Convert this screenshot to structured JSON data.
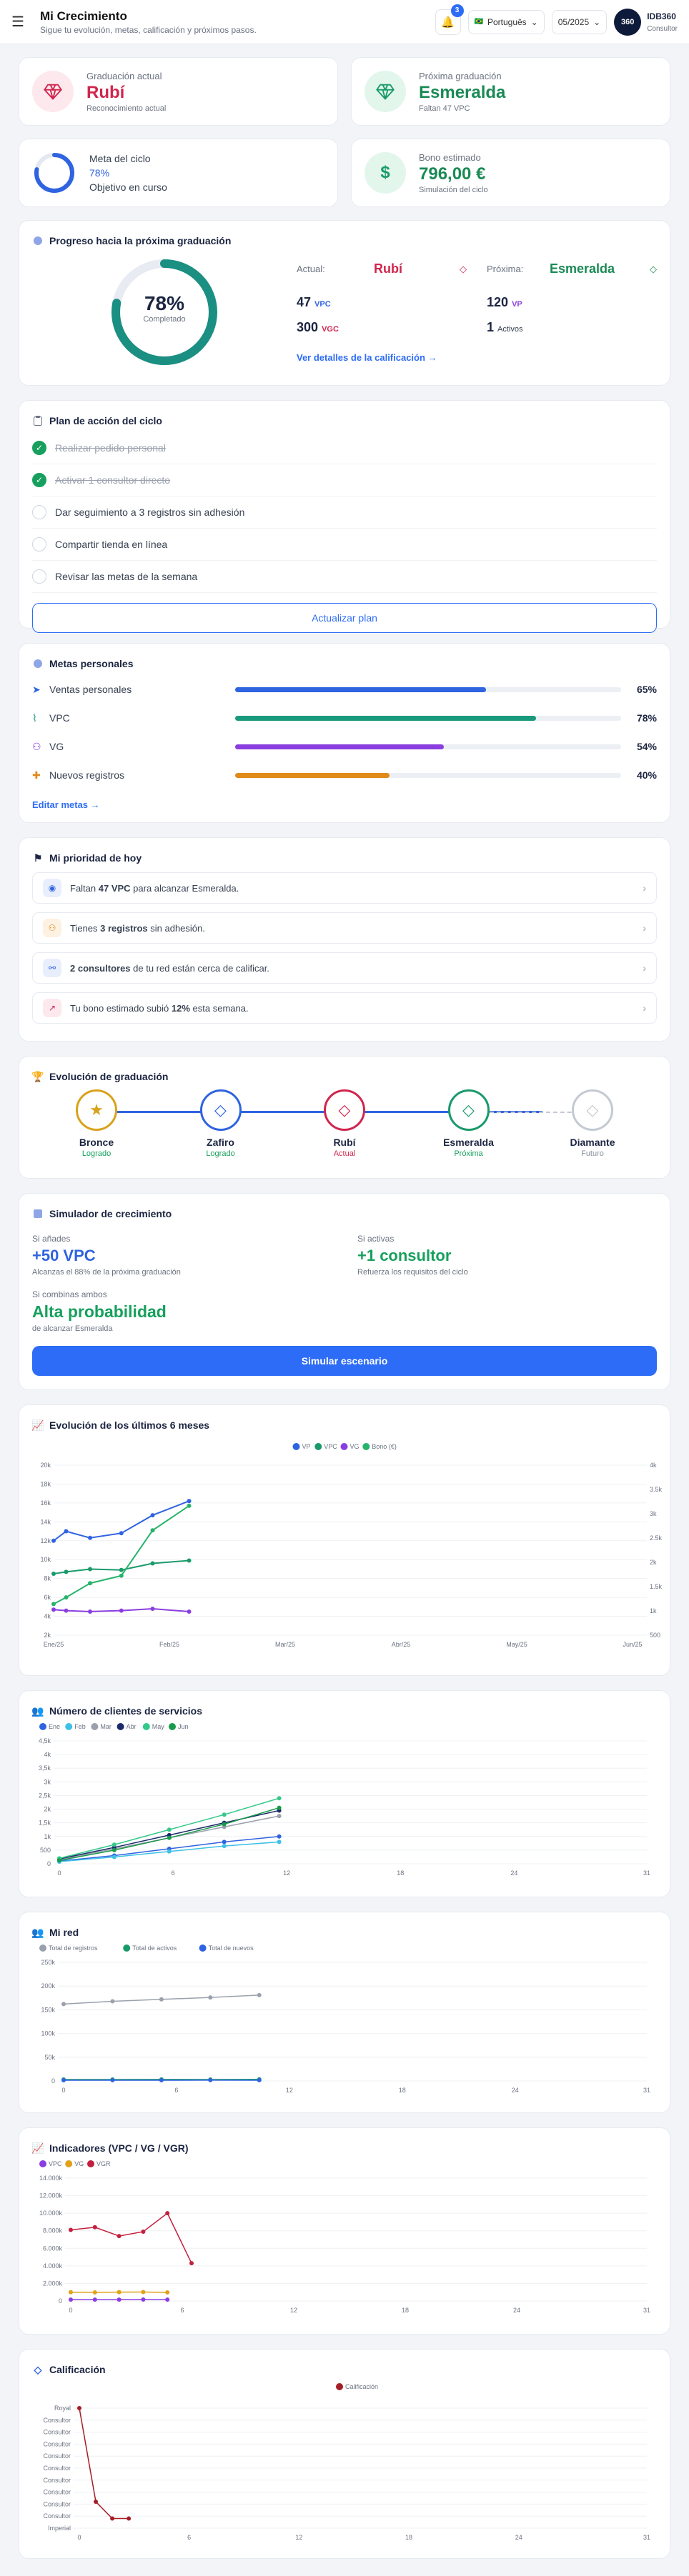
{
  "topbar": {
    "title": "Mi Crecimiento",
    "subtitle": "Sigue tu evolución, metas, calificación y próximos pasos.",
    "notif_count": "3",
    "language": "Português",
    "period": "05/2025",
    "avatar": "360",
    "user_id": "IDB360",
    "user_role": "Consultor"
  },
  "summary": {
    "current_grad": {
      "label": "Graduación actual",
      "value": "Rubí",
      "sub": "Reconocimiento actual"
    },
    "next_grad": {
      "label": "Próxima graduación",
      "value": "Esmeralda",
      "sub": "Faltan 47 VPC"
    },
    "cycle_goal": {
      "label": "Meta del ciclo",
      "value": "78%",
      "sub": "Objetivo en curso",
      "progress": 0.78
    },
    "bonus": {
      "label": "Bono estimado",
      "value": "796,00 €",
      "sub": "Simulación del ciclo"
    }
  },
  "progress": {
    "title": "Progreso hacia la próxima graduación",
    "pct": "78%",
    "pct_label": "Completado",
    "ring": 0.78,
    "current_label": "Actual:",
    "current_value": "Rubí",
    "next_label": "Próxima:",
    "next_value": "Esmeralda",
    "cur_vpc": "47",
    "cur_vpc_unit": "VPC",
    "cur_vgc": "300",
    "cur_vgc_unit": "VGC",
    "next_vp": "120",
    "next_vp_unit": "VP",
    "next_act": "1",
    "next_act_unit": "Activos",
    "details_link": "Ver detalles de la calificación →"
  },
  "plan": {
    "title": "Plan de acción del ciclo",
    "items": [
      {
        "label": "Realizar pedido personal",
        "done": true
      },
      {
        "label": "Activar 1 consultor directo",
        "done": true
      },
      {
        "label": "Dar seguimiento a 3 registros sin adhesión",
        "done": false
      },
      {
        "label": "Compartir tienda en línea",
        "done": false
      },
      {
        "label": "Revisar las metas de la semana",
        "done": false
      }
    ],
    "button": "Actualizar plan"
  },
  "goals": {
    "title": "Metas personales",
    "items": [
      {
        "label": "Ventas personales",
        "pct": "65%",
        "value": 0.65,
        "color": "#2f63e0"
      },
      {
        "label": "VPC",
        "pct": "78%",
        "value": 0.78,
        "color": "#1a9a7c"
      },
      {
        "label": "VG",
        "pct": "54%",
        "value": 0.54,
        "color": "#8a3ee0"
      },
      {
        "label": "Nuevos registros",
        "pct": "40%",
        "value": 0.4,
        "color": "#e08a1a"
      }
    ],
    "link": "Editar metas →"
  },
  "priority": {
    "title": "Mi prioridad de hoy",
    "items": [
      {
        "pre": "Faltan ",
        "bold": "47 VPC",
        "post": " para alcanzar Esmeralda."
      },
      {
        "pre": "Tienes ",
        "bold": "3 registros",
        "post": " sin adhesión."
      },
      {
        "pre": "",
        "bold": "2 consultores",
        "post": " de tu red están cerca de calificar."
      },
      {
        "pre": "Tu bono estimado subió ",
        "bold": "12%",
        "post": " esta semana."
      }
    ]
  },
  "evolution": {
    "title": "Evolución de graduación",
    "steps": [
      {
        "name": "Bronce",
        "status": "Logrado",
        "color": "#d9a21b",
        "scolor": "#17a05d"
      },
      {
        "name": "Zafiro",
        "status": "Logrado",
        "color": "#2f63e0",
        "scolor": "#17a05d"
      },
      {
        "name": "Rubí",
        "status": "Actual",
        "color": "#d0264d",
        "scolor": "#d0264d"
      },
      {
        "name": "Esmeralda",
        "status": "Próxima",
        "color": "#1a9a6b",
        "scolor": "#17a05d"
      },
      {
        "name": "Diamante",
        "status": "Futuro",
        "color": "#c4c9d2",
        "scolor": "#8a919e"
      }
    ]
  },
  "simulator": {
    "title": "Simulador de crecimiento",
    "a_label": "Si añades",
    "a_value": "+50 VPC",
    "a_sub": "Alcanzas el 88% de la próxima graduación",
    "b_label": "Si activas",
    "b_value": "+1 consultor",
    "b_sub": "Refuerza los requisitos del ciclo",
    "c_label": "Si combinas ambos",
    "c_value": "Alta probabilidad",
    "c_sub": "de alcanzar Esmeralda",
    "button": "Simular escenario"
  },
  "charts": {
    "evo6": {
      "title": "Evolución de los últimos 6 meses"
    },
    "clients": {
      "title": "Número de clientes de servicios"
    },
    "net": {
      "title": "Mi red"
    },
    "ind": {
      "title": "Indicadores (VPC / VG / VGR)"
    },
    "qual": {
      "title": "Calificación"
    }
  },
  "chart_data": [
    {
      "type": "line",
      "title": "Evolución de los últimos 6 meses",
      "categories": [
        "Ene/25",
        "Feb/25",
        "Mar/25",
        "Abr/25",
        "May/25",
        "Jun/25"
      ],
      "ylim": [
        2000,
        20000
      ],
      "y2lim": [
        500,
        4000
      ],
      "yticks": [
        "20k",
        "18k",
        "16k",
        "14k",
        "12k",
        "10k",
        "8k",
        "6k",
        "4k",
        "2k"
      ],
      "y2ticks": [
        "4k",
        "3.5k",
        "3k",
        "2.5k",
        "2k",
        "1.5k",
        "1k",
        "500"
      ],
      "series": [
        {
          "name": "VP",
          "color": "#2f63e0",
          "points": [
            [
              0,
              12000
            ],
            [
              0.12,
              13000
            ],
            [
              0.35,
              12300
            ],
            [
              0.65,
              12800
            ],
            [
              0.95,
              14700
            ],
            [
              1.3,
              16200
            ]
          ]
        },
        {
          "name": "VPC",
          "color": "#1a9a6b",
          "points": [
            [
              0,
              8500
            ],
            [
              0.12,
              8700
            ],
            [
              0.35,
              9000
            ],
            [
              0.65,
              8900
            ],
            [
              0.95,
              9600
            ],
            [
              1.3,
              9900
            ]
          ]
        },
        {
          "name": "VG",
          "color": "#8a3ee0",
          "points": [
            [
              0,
              4700
            ],
            [
              0.12,
              4600
            ],
            [
              0.35,
              4500
            ],
            [
              0.65,
              4600
            ],
            [
              0.95,
              4800
            ],
            [
              1.3,
              4500
            ]
          ]
        },
        {
          "name": "Bono (€)",
          "color": "#27b36b",
          "points": [
            [
              0,
              5300
            ],
            [
              0.12,
              6000
            ],
            [
              0.35,
              7500
            ],
            [
              0.65,
              8300
            ],
            [
              0.95,
              13100
            ],
            [
              1.3,
              15700
            ]
          ]
        }
      ]
    },
    {
      "type": "line",
      "title": "Número de clientes de servicios",
      "x": [
        0,
        6,
        12,
        18,
        24,
        31
      ],
      "ylim": [
        0,
        4500
      ],
      "yticks": [
        "4,5k",
        "4k",
        "3,5k",
        "3k",
        "2,5k",
        "2k",
        "1,5k",
        "1k",
        "500",
        "0"
      ],
      "series": [
        {
          "name": "Ene",
          "color": "#2f63e0",
          "values": [
            100,
            300,
            550,
            800,
            1000
          ]
        },
        {
          "name": "Feb",
          "color": "#3ec1e6",
          "values": [
            80,
            250,
            450,
            650,
            800
          ]
        },
        {
          "name": "Mar",
          "color": "#9aa1ad",
          "values": [
            150,
            550,
            950,
            1350,
            1750
          ]
        },
        {
          "name": "Abr",
          "color": "#1c2a6b",
          "values": [
            180,
            600,
            1050,
            1500,
            1950
          ]
        },
        {
          "name": "May",
          "color": "#34c98a",
          "values": [
            200,
            700,
            1250,
            1800,
            2400
          ]
        },
        {
          "name": "Jun",
          "color": "#1a9a4b",
          "values": [
            120,
            500,
            950,
            1450,
            2050
          ]
        }
      ]
    },
    {
      "type": "line",
      "title": "Mi red",
      "x": [
        0,
        6,
        12,
        18,
        24,
        31
      ],
      "ylim": [
        0,
        250000
      ],
      "yticks": [
        "250k",
        "200k",
        "150k",
        "100k",
        "50k",
        "0"
      ],
      "series": [
        {
          "name": "Total de registros",
          "color": "#9aa1ad",
          "values": [
            162000,
            168000,
            172000,
            176000,
            181000
          ]
        },
        {
          "name": "Total de activos",
          "color": "#1a9a6b",
          "values": [
            3000,
            3000,
            3200,
            3100,
            3300
          ]
        },
        {
          "name": "Total de nuevos",
          "color": "#2f63e0",
          "values": [
            1500,
            1600,
            1500,
            1700,
            1600
          ]
        }
      ]
    },
    {
      "type": "line",
      "title": "Indicadores (VPC / VG / VGR)",
      "x": [
        0,
        6,
        12,
        18,
        24,
        31
      ],
      "ylim": [
        0,
        14000
      ],
      "yticks": [
        "14.000k",
        "12.000k",
        "10.000k",
        "8.000k",
        "6.000k",
        "4.000k",
        "2.000k",
        "0"
      ],
      "series": [
        {
          "name": "VPC",
          "color": "#8a3ee0",
          "values": [
            150,
            150,
            150,
            160,
            150
          ]
        },
        {
          "name": "VG",
          "color": "#e0a21a",
          "values": [
            1000,
            980,
            1010,
            1020,
            980
          ]
        },
        {
          "name": "VGR",
          "color": "#c2203d",
          "values": [
            8100,
            8400,
            7400,
            7900,
            10000,
            4300
          ]
        }
      ]
    },
    {
      "type": "line",
      "title": "Calificación",
      "x": [
        0,
        6,
        12,
        18,
        24,
        31
      ],
      "yticks": [
        "Royal",
        "Consultor",
        "Consultor",
        "Consultor",
        "Consultor",
        "Consultor",
        "Consultor",
        "Consultor",
        "Consultor",
        "Consultor",
        "Imperial"
      ],
      "series": [
        {
          "name": "Calificación",
          "color": "#a41e26",
          "values": [
            10,
            2.2,
            0.8,
            0.8
          ]
        }
      ]
    }
  ]
}
